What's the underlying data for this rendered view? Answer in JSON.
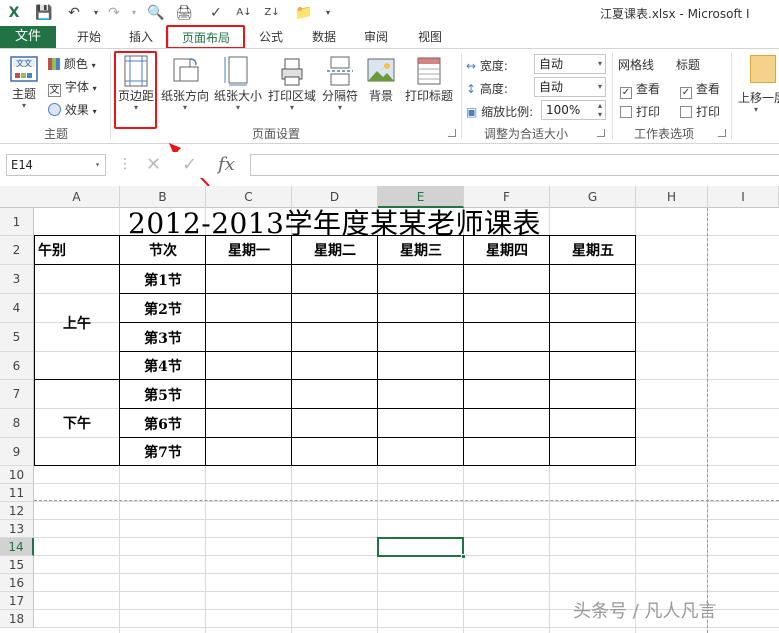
{
  "window": {
    "title": "江夏课表.xlsx - Microsoft I"
  },
  "tabs": {
    "file": "文件",
    "items": [
      "开始",
      "插入",
      "页面布局",
      "公式",
      "数据",
      "审阅",
      "视图"
    ],
    "active": "页面布局"
  },
  "ribbon": {
    "theme_group": {
      "label": "主题",
      "theme_button": "主题",
      "colors": "颜色",
      "fonts": "字体",
      "effects": "效果"
    },
    "page_setup_group": {
      "label": "页面设置",
      "margins": "页边距",
      "orientation": "纸张方向",
      "size": "纸张大小",
      "print_area": "打印区域",
      "breaks": "分隔符",
      "background": "背景",
      "print_titles": "打印标题"
    },
    "scale_group": {
      "label": "调整为合适大小",
      "width_label": "宽度:",
      "width_value": "自动",
      "height_label": "高度:",
      "height_value": "自动",
      "scale_label": "缩放比例:",
      "scale_value": "100%"
    },
    "sheet_options_group": {
      "label": "工作表选项",
      "gridlines": "网格线",
      "headings": "标题",
      "view": "查看",
      "print": "打印",
      "gridlines_view_checked": true,
      "gridlines_print_checked": false,
      "headings_view_checked": true,
      "headings_print_checked": false
    },
    "arrange_group": {
      "bring_forward": "上移一层"
    }
  },
  "formula_bar": {
    "name_box": "E14",
    "formula": ""
  },
  "grid": {
    "columns": [
      "A",
      "B",
      "C",
      "D",
      "E",
      "F",
      "G",
      "H",
      "I"
    ],
    "selected_column": "E",
    "rows": [
      "1",
      "2",
      "3",
      "4",
      "5",
      "6",
      "7",
      "8",
      "9",
      "10",
      "11",
      "12",
      "13",
      "14",
      "15",
      "16",
      "17",
      "18"
    ],
    "selected_row": "14"
  },
  "sheet": {
    "title": "2012-2013学年度某某老师课表",
    "header": {
      "period": "午别",
      "session": "节次",
      "days": [
        "星期一",
        "星期二",
        "星期三",
        "星期四",
        "星期五"
      ]
    },
    "morning": "上午",
    "afternoon": "下午",
    "sessions": [
      "第1节",
      "第2节",
      "第3节",
      "第4节",
      "第5节",
      "第6节",
      "第7节"
    ]
  },
  "watermark": "头条号 / 凡人凡言"
}
